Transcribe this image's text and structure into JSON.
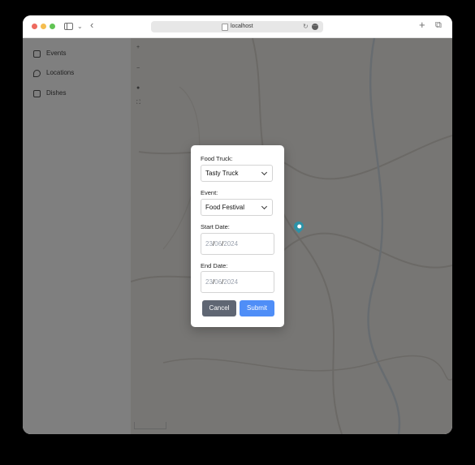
{
  "browser": {
    "url": "localhost"
  },
  "sidebar": {
    "items": [
      {
        "label": "Events",
        "icon": "calendar-icon"
      },
      {
        "label": "Locations",
        "icon": "location-pin-icon"
      },
      {
        "label": "Dishes",
        "icon": "dish-icon"
      }
    ]
  },
  "modal": {
    "food_truck": {
      "label": "Food Truck:",
      "value": "Tasty Truck"
    },
    "event": {
      "label": "Event:",
      "value": "Food Festival"
    },
    "start_date": {
      "label": "Start Date:",
      "day": "23",
      "month": "06",
      "year": "2024"
    },
    "end_date": {
      "label": "End Date:",
      "day": "23",
      "month": "06",
      "year": "2024"
    },
    "cancel_label": "Cancel",
    "submit_label": "Submit"
  },
  "colors": {
    "submit": "#4f8ef7",
    "cancel": "#5f6673",
    "pin": "#2d92a7"
  }
}
